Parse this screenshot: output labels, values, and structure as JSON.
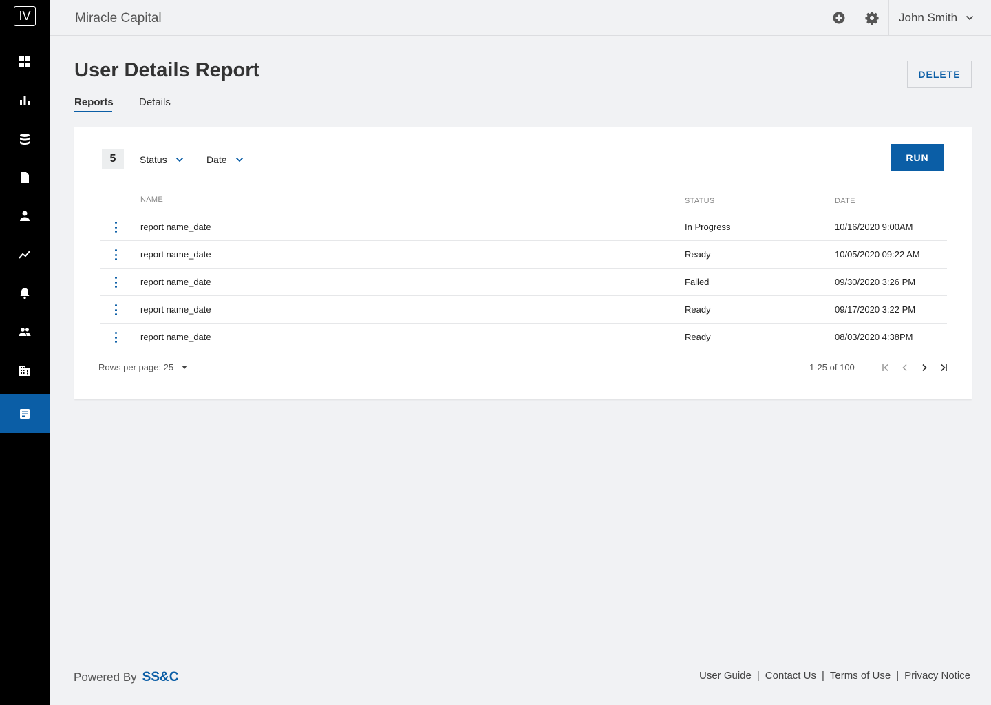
{
  "sidebar": {
    "logo": "IV",
    "items": [
      {
        "icon": "dashboard-icon"
      },
      {
        "icon": "bar-chart-icon"
      },
      {
        "icon": "database-icon"
      },
      {
        "icon": "document-icon"
      },
      {
        "icon": "person-icon"
      },
      {
        "icon": "trend-line-icon"
      },
      {
        "icon": "bell-icon"
      },
      {
        "icon": "group-icon"
      },
      {
        "icon": "building-icon"
      },
      {
        "icon": "report-icon",
        "active": true
      }
    ],
    "accent_color": "#0b5ea6"
  },
  "topbar": {
    "app_title": "Miracle Capital",
    "user_name": "John Smith"
  },
  "header": {
    "title": "User Details Report",
    "delete_label": "DELETE",
    "tabs": [
      {
        "label": "Reports",
        "active": true
      },
      {
        "label": "Details",
        "active": false
      }
    ]
  },
  "toolbar": {
    "count": "5",
    "filters": [
      {
        "label": "Status"
      },
      {
        "label": "Date"
      }
    ],
    "run_label": "RUN"
  },
  "table": {
    "columns": [
      "Name",
      "Status",
      "Date"
    ],
    "rows": [
      {
        "name": "report name_date",
        "status": "In Progress",
        "date": "10/16/2020 9:00AM"
      },
      {
        "name": "report name_date",
        "status": "Ready",
        "date": "10/05/2020 09:22 AM"
      },
      {
        "name": "report name_date",
        "status": "Failed",
        "date": "09/30/2020 3:26 PM"
      },
      {
        "name": "report name_date",
        "status": "Ready",
        "date": "09/17/2020 3:22 PM"
      },
      {
        "name": "report name_date",
        "status": "Ready",
        "date": "08/03/2020 4:38PM"
      }
    ]
  },
  "pagination": {
    "rows_per_page": "Rows per page: 25",
    "range": "1-25 of 100"
  },
  "footer": {
    "powered_by": "Powered By",
    "brand": "SS&C",
    "links": [
      "User Guide",
      "Contact Us",
      "Terms of Use",
      "Privacy Notice"
    ]
  }
}
